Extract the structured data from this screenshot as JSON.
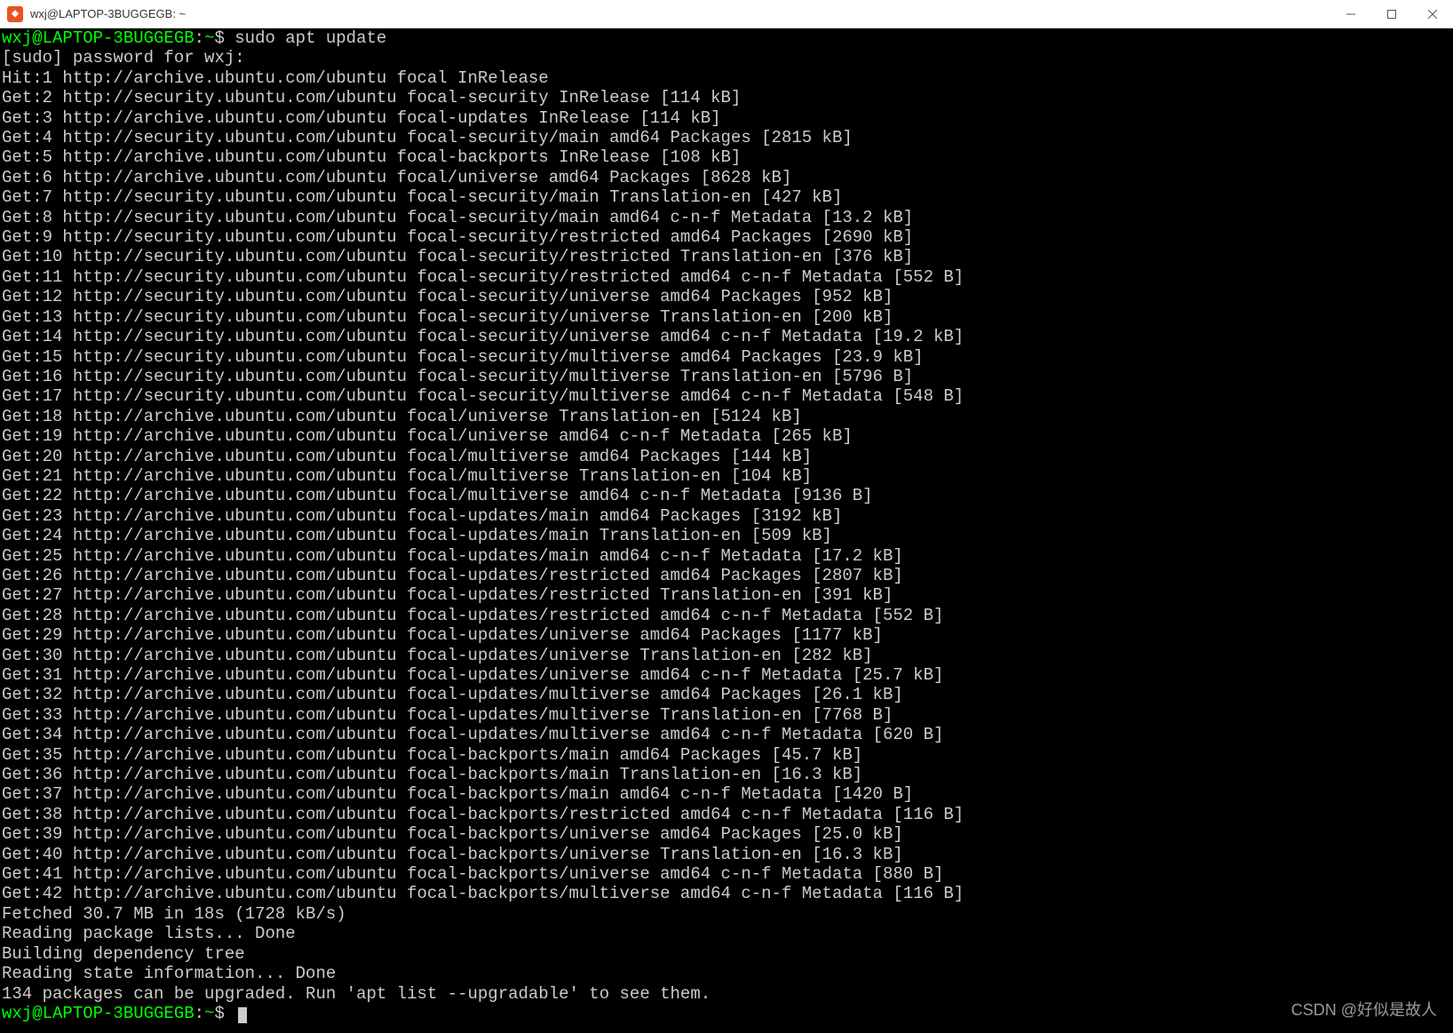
{
  "window": {
    "title": "wxj@LAPTOP-3BUGGEGB: ~"
  },
  "prompt": {
    "user_host": "wxj@LAPTOP-3BUGGEGB",
    "path": "~",
    "symbol": "$"
  },
  "command": "sudo apt update",
  "lines": [
    "[sudo] password for wxj:",
    "Hit:1 http://archive.ubuntu.com/ubuntu focal InRelease",
    "Get:2 http://security.ubuntu.com/ubuntu focal-security InRelease [114 kB]",
    "Get:3 http://archive.ubuntu.com/ubuntu focal-updates InRelease [114 kB]",
    "Get:4 http://security.ubuntu.com/ubuntu focal-security/main amd64 Packages [2815 kB]",
    "Get:5 http://archive.ubuntu.com/ubuntu focal-backports InRelease [108 kB]",
    "Get:6 http://archive.ubuntu.com/ubuntu focal/universe amd64 Packages [8628 kB]",
    "Get:7 http://security.ubuntu.com/ubuntu focal-security/main Translation-en [427 kB]",
    "Get:8 http://security.ubuntu.com/ubuntu focal-security/main amd64 c-n-f Metadata [13.2 kB]",
    "Get:9 http://security.ubuntu.com/ubuntu focal-security/restricted amd64 Packages [2690 kB]",
    "Get:10 http://security.ubuntu.com/ubuntu focal-security/restricted Translation-en [376 kB]",
    "Get:11 http://security.ubuntu.com/ubuntu focal-security/restricted amd64 c-n-f Metadata [552 B]",
    "Get:12 http://security.ubuntu.com/ubuntu focal-security/universe amd64 Packages [952 kB]",
    "Get:13 http://security.ubuntu.com/ubuntu focal-security/universe Translation-en [200 kB]",
    "Get:14 http://security.ubuntu.com/ubuntu focal-security/universe amd64 c-n-f Metadata [19.2 kB]",
    "Get:15 http://security.ubuntu.com/ubuntu focal-security/multiverse amd64 Packages [23.9 kB]",
    "Get:16 http://security.ubuntu.com/ubuntu focal-security/multiverse Translation-en [5796 B]",
    "Get:17 http://security.ubuntu.com/ubuntu focal-security/multiverse amd64 c-n-f Metadata [548 B]",
    "Get:18 http://archive.ubuntu.com/ubuntu focal/universe Translation-en [5124 kB]",
    "Get:19 http://archive.ubuntu.com/ubuntu focal/universe amd64 c-n-f Metadata [265 kB]",
    "Get:20 http://archive.ubuntu.com/ubuntu focal/multiverse amd64 Packages [144 kB]",
    "Get:21 http://archive.ubuntu.com/ubuntu focal/multiverse Translation-en [104 kB]",
    "Get:22 http://archive.ubuntu.com/ubuntu focal/multiverse amd64 c-n-f Metadata [9136 B]",
    "Get:23 http://archive.ubuntu.com/ubuntu focal-updates/main amd64 Packages [3192 kB]",
    "Get:24 http://archive.ubuntu.com/ubuntu focal-updates/main Translation-en [509 kB]",
    "Get:25 http://archive.ubuntu.com/ubuntu focal-updates/main amd64 c-n-f Metadata [17.2 kB]",
    "Get:26 http://archive.ubuntu.com/ubuntu focal-updates/restricted amd64 Packages [2807 kB]",
    "Get:27 http://archive.ubuntu.com/ubuntu focal-updates/restricted Translation-en [391 kB]",
    "Get:28 http://archive.ubuntu.com/ubuntu focal-updates/restricted amd64 c-n-f Metadata [552 B]",
    "Get:29 http://archive.ubuntu.com/ubuntu focal-updates/universe amd64 Packages [1177 kB]",
    "Get:30 http://archive.ubuntu.com/ubuntu focal-updates/universe Translation-en [282 kB]",
    "Get:31 http://archive.ubuntu.com/ubuntu focal-updates/universe amd64 c-n-f Metadata [25.7 kB]",
    "Get:32 http://archive.ubuntu.com/ubuntu focal-updates/multiverse amd64 Packages [26.1 kB]",
    "Get:33 http://archive.ubuntu.com/ubuntu focal-updates/multiverse Translation-en [7768 B]",
    "Get:34 http://archive.ubuntu.com/ubuntu focal-updates/multiverse amd64 c-n-f Metadata [620 B]",
    "Get:35 http://archive.ubuntu.com/ubuntu focal-backports/main amd64 Packages [45.7 kB]",
    "Get:36 http://archive.ubuntu.com/ubuntu focal-backports/main Translation-en [16.3 kB]",
    "Get:37 http://archive.ubuntu.com/ubuntu focal-backports/main amd64 c-n-f Metadata [1420 B]",
    "Get:38 http://archive.ubuntu.com/ubuntu focal-backports/restricted amd64 c-n-f Metadata [116 B]",
    "Get:39 http://archive.ubuntu.com/ubuntu focal-backports/universe amd64 Packages [25.0 kB]",
    "Get:40 http://archive.ubuntu.com/ubuntu focal-backports/universe Translation-en [16.3 kB]",
    "Get:41 http://archive.ubuntu.com/ubuntu focal-backports/universe amd64 c-n-f Metadata [880 B]",
    "Get:42 http://archive.ubuntu.com/ubuntu focal-backports/multiverse amd64 c-n-f Metadata [116 B]",
    "Fetched 30.7 MB in 18s (1728 kB/s)",
    "Reading package lists... Done",
    "Building dependency tree",
    "Reading state information... Done",
    "134 packages can be upgraded. Run 'apt list --upgradable' to see them."
  ],
  "watermark": "CSDN @好似是故人"
}
